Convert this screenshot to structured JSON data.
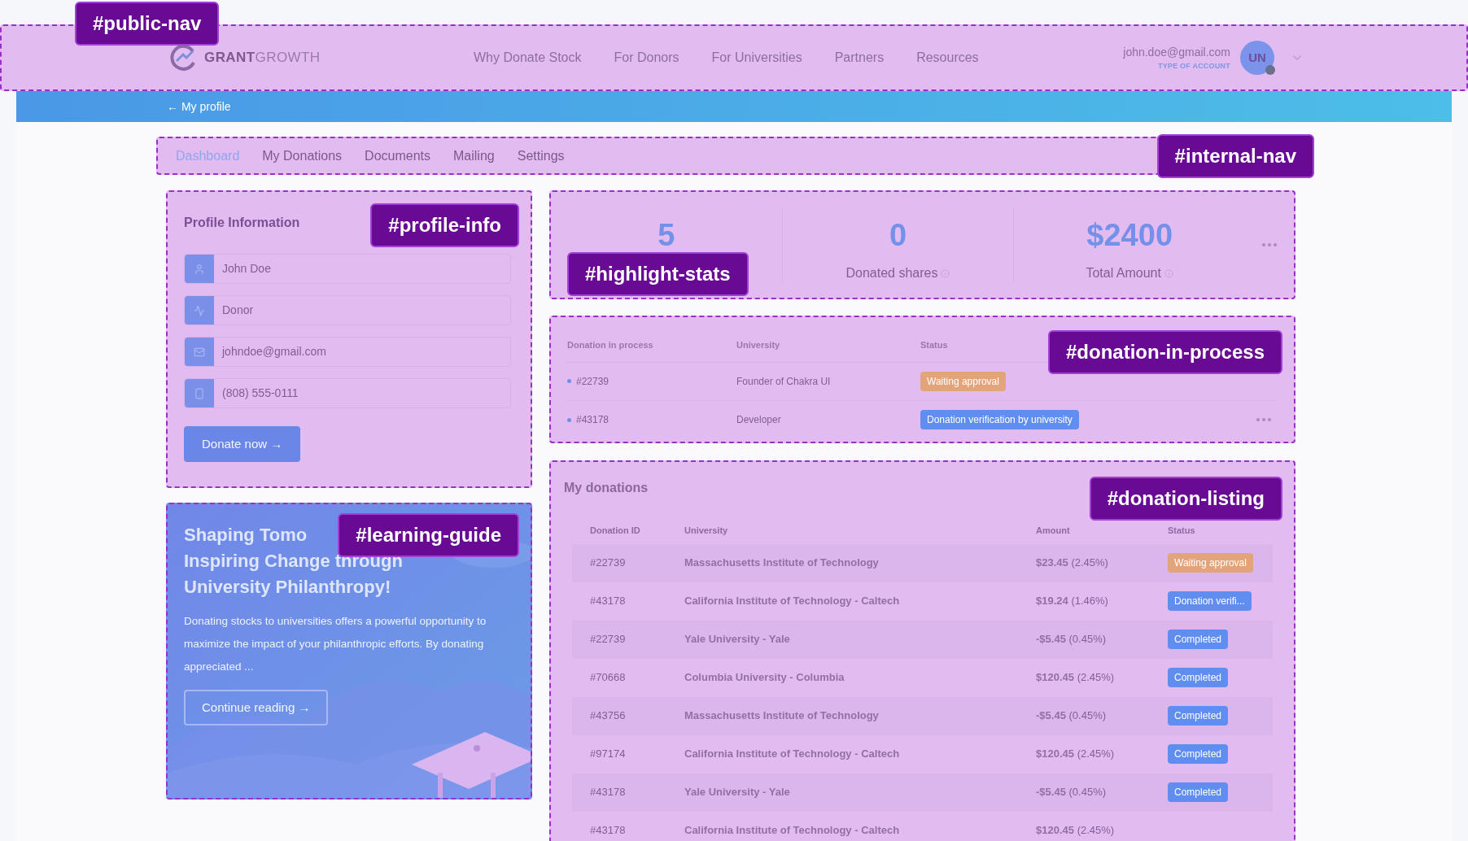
{
  "public_nav": {
    "tag": "#public-nav",
    "logo": {
      "bold": "GRANT",
      "light": "GROWTH"
    },
    "links": [
      "Why Donate Stock",
      "For Donors",
      "For Universities",
      "Partners",
      "Resources"
    ],
    "user": {
      "email": "john.doe@gmail.com",
      "account_type": "TYPE OF ACCOUNT",
      "initials": "UN"
    }
  },
  "breadcrumb": {
    "label": "← My profile"
  },
  "internal_nav": {
    "tag": "#internal-nav",
    "tabs": [
      {
        "label": "Dashboard",
        "selected": true
      },
      {
        "label": "My Donations",
        "selected": false
      },
      {
        "label": "Documents",
        "selected": false
      },
      {
        "label": "Mailing",
        "selected": false
      },
      {
        "label": "Settings",
        "selected": false
      }
    ]
  },
  "profile_info": {
    "tag": "#profile-info",
    "title": "Profile Information",
    "fields": [
      {
        "kind": "name",
        "value": "John Doe"
      },
      {
        "kind": "role",
        "value": "Donor"
      },
      {
        "kind": "email",
        "value": "johndoe@gmail.com"
      },
      {
        "kind": "phone",
        "value": "(808) 555-0111"
      }
    ],
    "button": "Donate now →"
  },
  "learning_guide": {
    "tag": "#learning-guide",
    "title_lines": [
      "Shaping Tomo",
      "Inspiring Change through",
      "University Philanthropy!"
    ],
    "body": "Donating stocks to universities offers a powerful opportunity to maximize the impact of your philanthropic efforts. By donating appreciated ...",
    "button": "Continue reading →"
  },
  "highlight_stats": {
    "tag": "#highlight-stats",
    "stats": [
      {
        "value": "5"
      },
      {
        "value": "0",
        "label": "Donated shares"
      },
      {
        "value": "$2400",
        "label": "Total Amount"
      }
    ]
  },
  "donation_in_process": {
    "tag": "#donation-in-process",
    "columns": [
      "Donation in process",
      "University",
      "Status"
    ],
    "rows": [
      {
        "id": "#22739",
        "university": "Founder of Chakra UI",
        "status": "Waiting approval",
        "color": "#e3a47c",
        "menu": false
      },
      {
        "id": "#43178",
        "university": "Developer",
        "status": "Donation verification by university",
        "color": "#5f8ef0",
        "menu": true
      }
    ]
  },
  "donation_listing": {
    "tag": "#donation-listing",
    "title": "My donations",
    "columns": [
      "Donation ID",
      "University",
      "Amount",
      "Status"
    ],
    "rows": [
      {
        "id": "#22739",
        "university": "Massachusetts Institute of Technology",
        "amount": "$23.45",
        "share": "(2.45%)",
        "status": "Waiting approval",
        "color": "#e3a47c"
      },
      {
        "id": "#43178",
        "university": "California Institute of Technology - Caltech",
        "amount": "$19.24",
        "share": "(1.46%)",
        "status": "Donation verifi...",
        "color": "#5f8ef0"
      },
      {
        "id": "#22739",
        "university": "Yale University - Yale",
        "amount": "-$5.45",
        "share": "(0.45%)",
        "status": "Completed",
        "color": "#5f8ef0"
      },
      {
        "id": "#70668",
        "university": "Columbia University - Columbia",
        "amount": "$120.45",
        "share": "(2.45%)",
        "status": "Completed",
        "color": "#5f8ef0"
      },
      {
        "id": "#43756",
        "university": "Massachusetts Institute of Technology",
        "amount": "-$5.45",
        "share": "(0.45%)",
        "status": "Completed",
        "color": "#5f8ef0"
      },
      {
        "id": "#97174",
        "university": "California Institute of Technology - Caltech",
        "amount": "$120.45",
        "share": "(2.45%)",
        "status": "Completed",
        "color": "#5f8ef0"
      },
      {
        "id": "#43178",
        "university": "Yale University - Yale",
        "amount": "-$5.45",
        "share": "(0.45%)",
        "status": "Completed",
        "color": "#5f8ef0"
      },
      {
        "id": "#43178",
        "university": "California Institute of Technology - Caltech",
        "amount": "$120.45",
        "share": "(2.45%)"
      }
    ]
  }
}
